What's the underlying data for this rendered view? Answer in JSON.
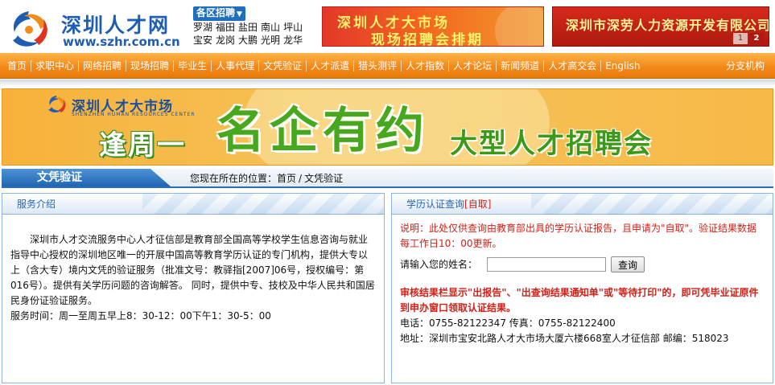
{
  "header": {
    "logo_name": "深圳人才网",
    "logo_url": "www.szhr.com.cn",
    "districts_title": "各区招聘",
    "districts_row1": [
      "罗湖",
      "福田",
      "盐田",
      "南山",
      "坪山"
    ],
    "districts_row2": [
      "宝安",
      "龙岗",
      "大鹏",
      "光明",
      "龙华"
    ],
    "ad_market_line1": "深圳人才大市场",
    "ad_market_line2": "现场招聘会排期",
    "ad_company_text": "深圳市深劳人力资源开发有限公司",
    "ad_pages": [
      "1",
      "2"
    ]
  },
  "nav": {
    "items": [
      "首页",
      "求职中心",
      "网络招聘",
      "现场招聘",
      "毕业生",
      "人事代理",
      "文凭验证",
      "人才派遣",
      "猎头测评",
      "人才指数",
      "人才论坛",
      "新闻频道",
      "人才高交会",
      "English"
    ],
    "last": "分支机构"
  },
  "banner": {
    "brand_name": "深圳人才大市场",
    "brand_en": "SHENZHEN HUMAN RESOURCES CENTER",
    "slogan_a": "逢周一",
    "slogan_b": "名企有约",
    "slogan_c": "大型人才招聘会"
  },
  "breadcrumb": {
    "tab_label": "文凭验证",
    "prefix": "您现在所在的位置：",
    "home": "首页",
    "separator": "/",
    "current": "文凭验证"
  },
  "left_panel": {
    "title": "服务介绍",
    "paragraph": "深圳市人才交流服务中心人才征信部是教育部全国高等学校学生信息咨询与就业指导中心授权的深圳地区唯一的开展中国高等教育学历认证的专门机构，提供大专以上（含大专）境内文凭的验证服务（批准文号：教驿指[2007]06号，授权编号：第016号）。提供有关学历问题的咨询解答。 同时，提供中专、技校及中华人民共和国居民身份证验证服务。",
    "hours": "服务时间：周一至周五早上8：30-12：00下午1：30-5：00"
  },
  "right_panel": {
    "title": "学历认证查询",
    "title_accent": "[自取]",
    "note": "说明：此处仅供查询由教育部出具的学历认证报告，且申请为\"自取\"。验证结果数据每工作日10：00更新。",
    "name_label": "请输入您的姓名：",
    "name_value": "",
    "search_button": "查询",
    "warning": "审核结果栏显示\"出报告\"、\"出查询结果通知单\"或\"等待打印\"的，即可凭毕业证原件到申办窗口领取认证结果。",
    "phone": "电话：0755-82122347 传真：0755-82122400",
    "address": "地址：深圳市宝安北路人才大市场大厦六楼668室人才征信部 邮编：518023"
  },
  "colors": {
    "nav_orange": "#f4891a",
    "brand_blue": "#1e5db4",
    "alert_red": "#d31f16",
    "banner_green": "#47a81e"
  }
}
